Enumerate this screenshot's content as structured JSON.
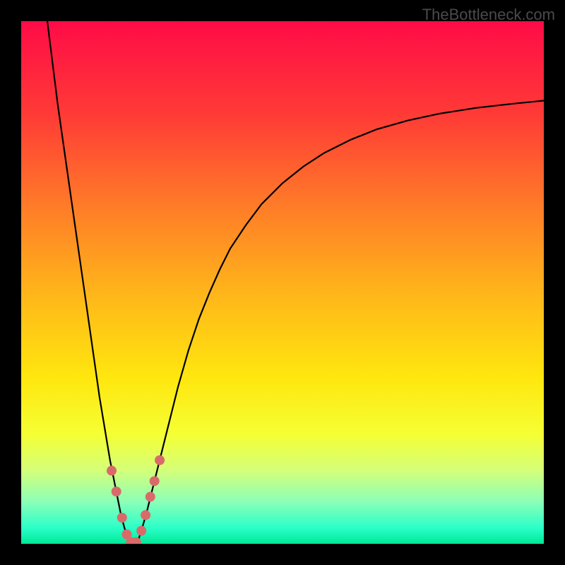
{
  "watermark": "TheBottleneck.com",
  "chart_data": {
    "type": "line",
    "title": "",
    "xlabel": "",
    "ylabel": "",
    "xlim": [
      0,
      100
    ],
    "ylim": [
      0,
      100
    ],
    "background_gradient": {
      "type": "vertical",
      "stops": [
        {
          "offset": 0,
          "color": "#ff0b47"
        },
        {
          "offset": 18,
          "color": "#ff3b36"
        },
        {
          "offset": 35,
          "color": "#ff7a28"
        },
        {
          "offset": 52,
          "color": "#ffb51a"
        },
        {
          "offset": 68,
          "color": "#ffe60e"
        },
        {
          "offset": 79,
          "color": "#f5ff33"
        },
        {
          "offset": 86,
          "color": "#d4ff7a"
        },
        {
          "offset": 92,
          "color": "#8affb8"
        },
        {
          "offset": 97,
          "color": "#2affc8"
        },
        {
          "offset": 100,
          "color": "#00e896"
        }
      ]
    },
    "series": [
      {
        "name": "bottleneck-curve",
        "color": "#000000",
        "stroke_width": 2.2,
        "x": [
          5,
          6,
          7,
          8,
          9,
          10,
          11,
          12,
          13,
          14,
          15,
          16,
          17,
          18,
          18.5,
          19,
          19.5,
          20,
          20.5,
          21,
          21.5,
          22,
          22.5,
          23,
          24,
          25,
          26,
          27,
          28,
          29,
          30,
          32,
          34,
          36,
          38,
          40,
          43,
          46,
          50,
          54,
          58,
          63,
          68,
          74,
          80,
          87,
          94,
          100
        ],
        "y": [
          100,
          92,
          84,
          77,
          70,
          63,
          56,
          49,
          42,
          35,
          28,
          22,
          16,
          11,
          8.5,
          6,
          4,
          2.2,
          1,
          0.3,
          0,
          0.2,
          1,
          2.5,
          6,
          10,
          14,
          18,
          22,
          26,
          30,
          37,
          43,
          48,
          52.5,
          56.5,
          61,
          65,
          69,
          72.2,
          74.8,
          77.3,
          79.3,
          81,
          82.3,
          83.4,
          84.2,
          84.8
        ]
      }
    ],
    "markers": {
      "color": "#d96a6a",
      "radius": 7,
      "points": [
        {
          "x": 17.3,
          "y": 14
        },
        {
          "x": 18.2,
          "y": 10
        },
        {
          "x": 19.3,
          "y": 5
        },
        {
          "x": 20.2,
          "y": 1.8
        },
        {
          "x": 21,
          "y": 0.3
        },
        {
          "x": 22,
          "y": 0.3
        },
        {
          "x": 23,
          "y": 2.5
        },
        {
          "x": 23.8,
          "y": 5.5
        },
        {
          "x": 24.7,
          "y": 9
        },
        {
          "x": 25.5,
          "y": 12
        },
        {
          "x": 26.5,
          "y": 16
        }
      ]
    }
  }
}
